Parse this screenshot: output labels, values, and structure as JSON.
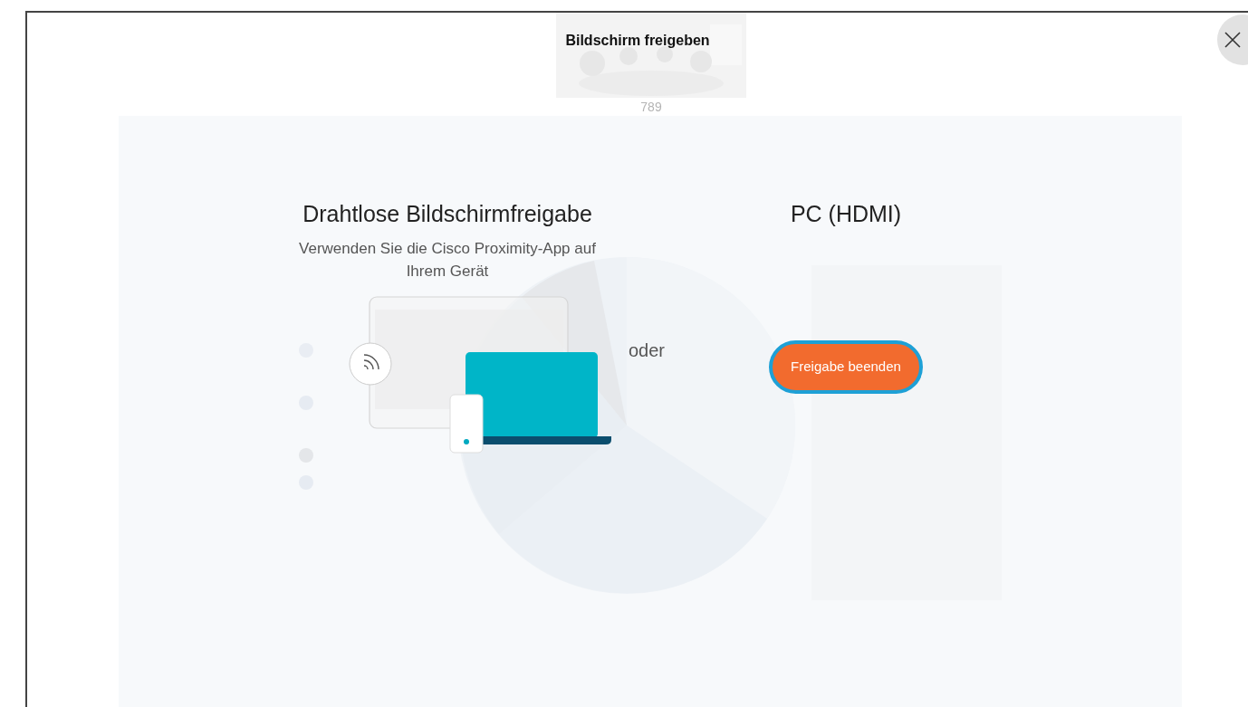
{
  "dialog": {
    "title": "Bildschirm freigeben"
  },
  "self_view": {
    "label": "789"
  },
  "options": [
    {
      "kind": "wireless",
      "title": "Drahtlose Bildschirmfreigabe",
      "description": "Verwenden Sie die Cisco Proximity-App auf Ihrem Gerät"
    },
    {
      "kind": "separator",
      "text": "oder"
    },
    {
      "kind": "hdmi",
      "title": "PC (HDMI)",
      "button": "Freigabe beenden"
    }
  ]
}
